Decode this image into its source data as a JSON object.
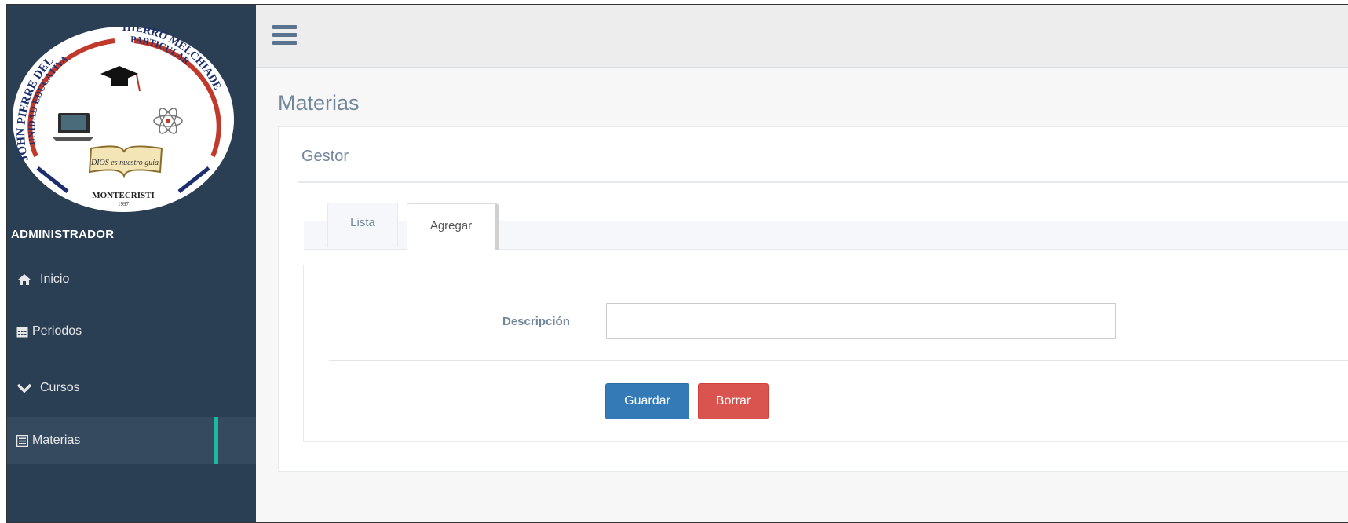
{
  "sidebar": {
    "logo": {
      "text_top_left": "UNIDAD EDUCATIVA",
      "text_top_left_2": "JOHN PIERRE DEL",
      "text_top_right": "PARTICULAR",
      "text_top_right_2": "HIERRO MELCHIADE",
      "book_text": "DIOS es nuestro guía",
      "city": "MONTECRISTI",
      "year": "1997"
    },
    "section_title": "ADMINISTRADOR",
    "items": [
      {
        "label": "Inicio",
        "icon": "home-icon"
      },
      {
        "label": "Periodos",
        "icon": "calendar-icon"
      },
      {
        "label": "Cursos",
        "icon": "chevron-down-icon"
      },
      {
        "label": "Materias",
        "icon": "list-alt-icon",
        "active": true
      }
    ],
    "colors": {
      "background": "#2a3f54",
      "active_indicator": "#1ABB9C"
    }
  },
  "topbar": {
    "menu_icon": "hamburger-icon"
  },
  "page": {
    "title": "Materias",
    "panel_title": "Gestor",
    "tabs": [
      {
        "label": "Lista",
        "active": false
      },
      {
        "label": "Agregar",
        "active": true
      }
    ],
    "form": {
      "description_label": "Descripción",
      "description_value": "",
      "description_placeholder": "",
      "save_label": "Guardar",
      "clear_label": "Borrar"
    }
  }
}
